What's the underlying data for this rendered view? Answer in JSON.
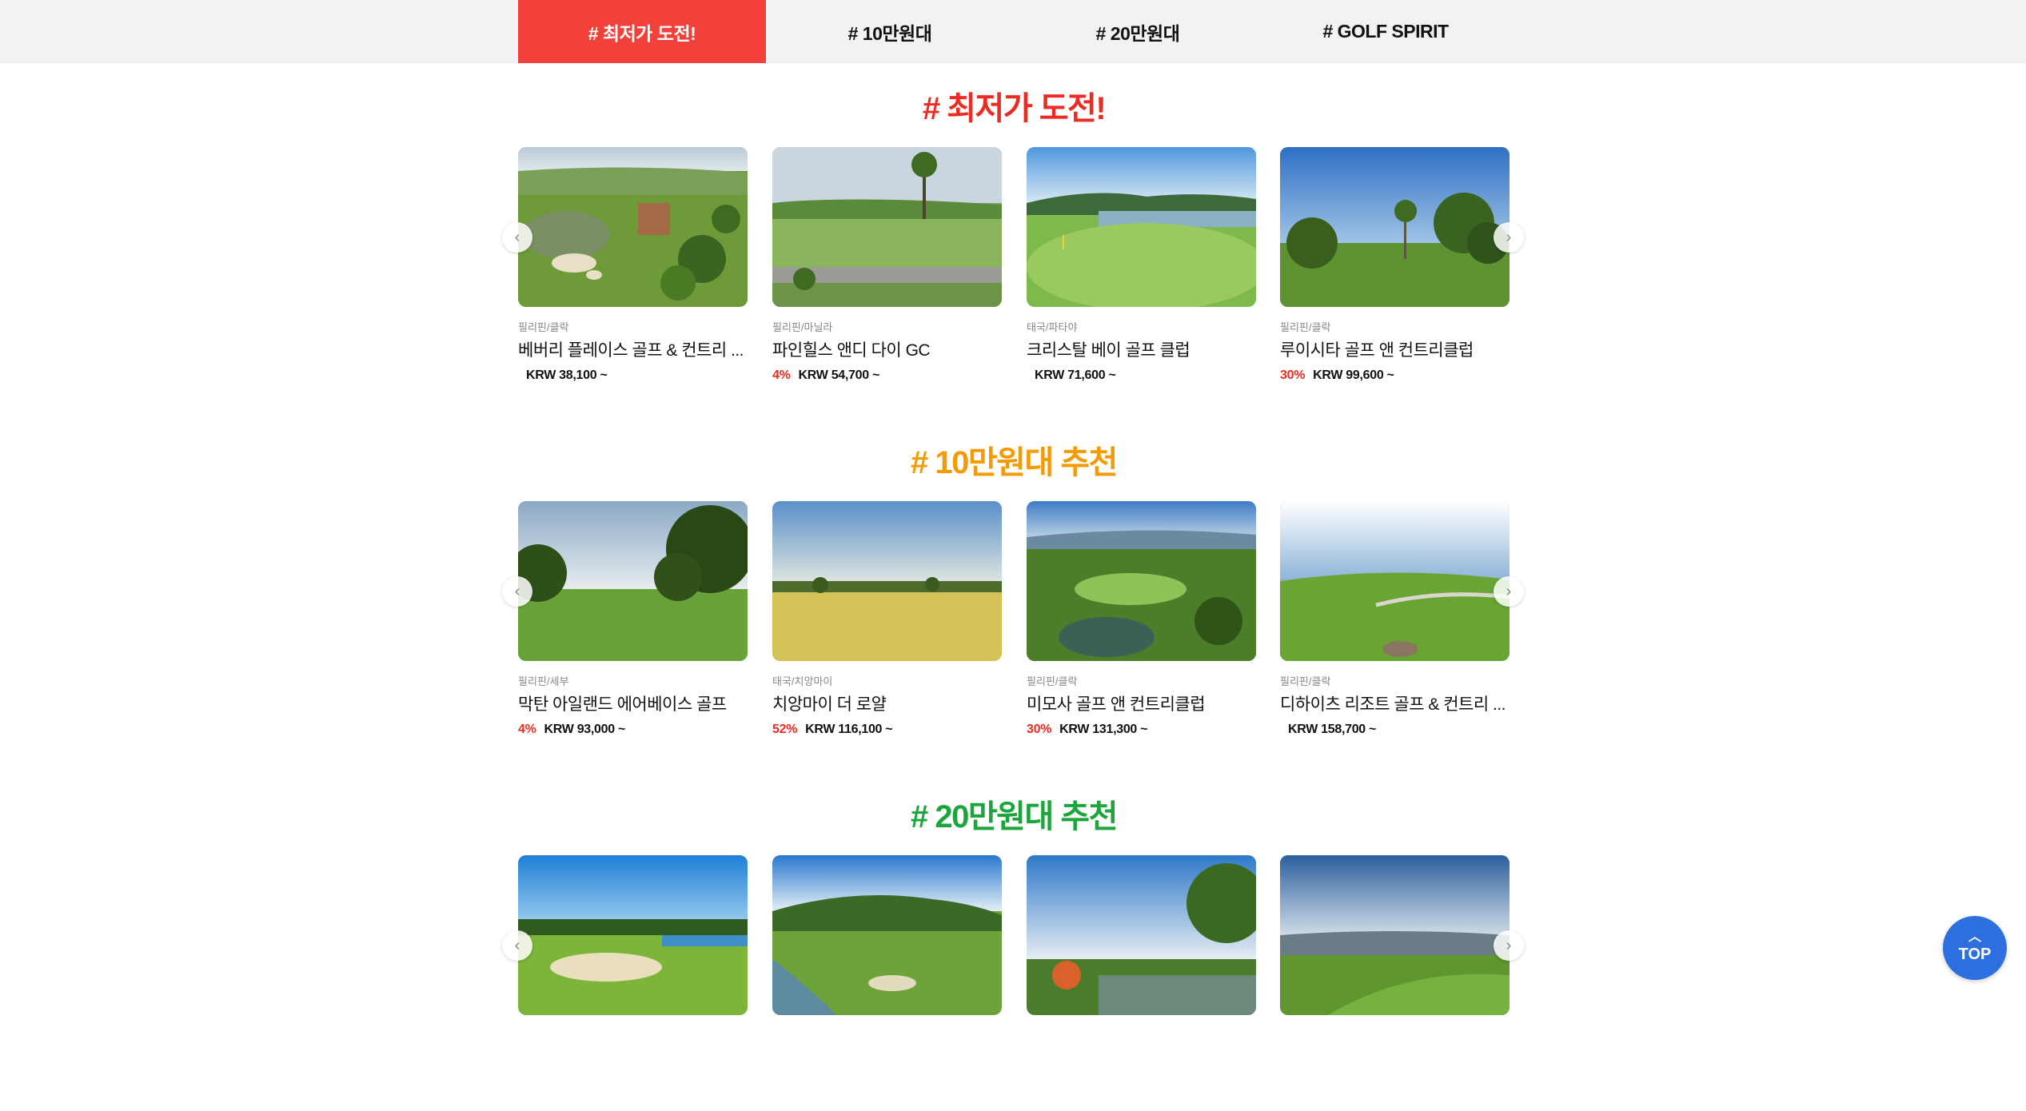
{
  "tabs": [
    {
      "label": "# 최저가 도전!",
      "active": true
    },
    {
      "label": "# 10만원대",
      "active": false
    },
    {
      "label": "# 20만원대",
      "active": false
    },
    {
      "label": "# GOLF SPIRIT",
      "active": false
    }
  ],
  "sections": [
    {
      "title": "# 최저가 도전!",
      "color": "#ec2c22",
      "cards": [
        {
          "region": "필리핀/클락",
          "name": "베버리 플레이스 골프 & 컨트리 ...",
          "discount": "",
          "price": "KRW 38,100 ~"
        },
        {
          "region": "필리핀/마닐라",
          "name": "파인힐스 앤디 다이 GC",
          "discount": "4%",
          "price": "KRW 54,700 ~"
        },
        {
          "region": "태국/파타야",
          "name": "크리스탈 베이 골프 클럽",
          "discount": "",
          "price": "KRW 71,600 ~"
        },
        {
          "region": "필리핀/클락",
          "name": "루이시타 골프 앤 컨트리클럽",
          "discount": "30%",
          "price": "KRW 99,600 ~"
        }
      ]
    },
    {
      "title": "# 10만원대 추천",
      "color": "#f39a05",
      "cards": [
        {
          "region": "필리핀/세부",
          "name": "막탄 아일랜드 에어베이스 골프",
          "discount": "4%",
          "price": "KRW 93,000 ~"
        },
        {
          "region": "태국/치앙마이",
          "name": "치앙마이 더 로얄",
          "discount": "52%",
          "price": "KRW 116,100 ~"
        },
        {
          "region": "필리핀/클락",
          "name": "미모사 골프 앤 컨트리클럽",
          "discount": "30%",
          "price": "KRW 131,300 ~"
        },
        {
          "region": "필리핀/클락",
          "name": "디하이츠 리조트 골프 & 컨트리 ...",
          "discount": "",
          "price": "KRW 158,700 ~"
        }
      ]
    },
    {
      "title": "# 20만원대 추천",
      "color": "#1ba53c",
      "cards": []
    }
  ],
  "carousel": {
    "prev_icon": "chevron-left-icon",
    "next_icon": "chevron-right-icon",
    "prev_glyph": "‹",
    "next_glyph": "›"
  },
  "top_button": {
    "label": "TOP",
    "icon": "chevron-up-icon",
    "glyph": "︿",
    "color": "#2e6fe0"
  }
}
